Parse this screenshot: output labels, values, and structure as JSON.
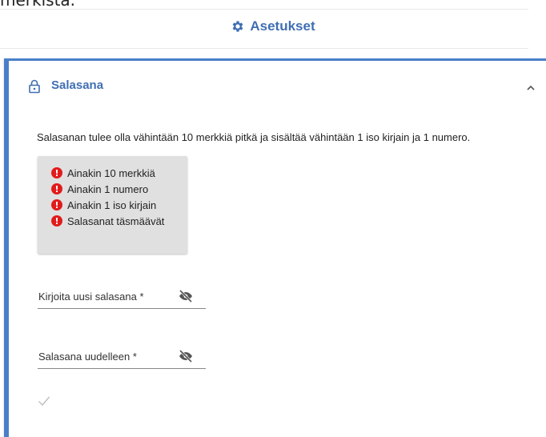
{
  "top_fragment": "merkistä.",
  "header": {
    "title": "Asetukset",
    "icon": "gear-icon",
    "accent": "#3f6fb3"
  },
  "panel": {
    "title": "Salasana",
    "icon": "lock-icon",
    "collapse_icon": "chevron-up-icon",
    "border_color": "#4a7fc8",
    "description": "Salasanan tulee olla vähintään 10 merkkiä pitkä ja sisältää vähintään 1 iso kirjain ja 1 numero.",
    "requirements": [
      {
        "label": "Ainakin 10 merkkiä",
        "icon": "error-icon"
      },
      {
        "label": "Ainakin 1 numero",
        "icon": "error-icon"
      },
      {
        "label": "Ainakin 1 iso kirjain",
        "icon": "error-icon"
      },
      {
        "label": "Salasanat täsmäävät",
        "icon": "error-icon"
      }
    ],
    "error_color": "#e11b1b",
    "fields": [
      {
        "label": "Kirjoita uusi salasana *",
        "icon": "eye-off-icon"
      },
      {
        "label": "Salasana uudelleen *",
        "icon": "eye-off-icon"
      }
    ],
    "submit_icon": "checkmark-icon"
  }
}
